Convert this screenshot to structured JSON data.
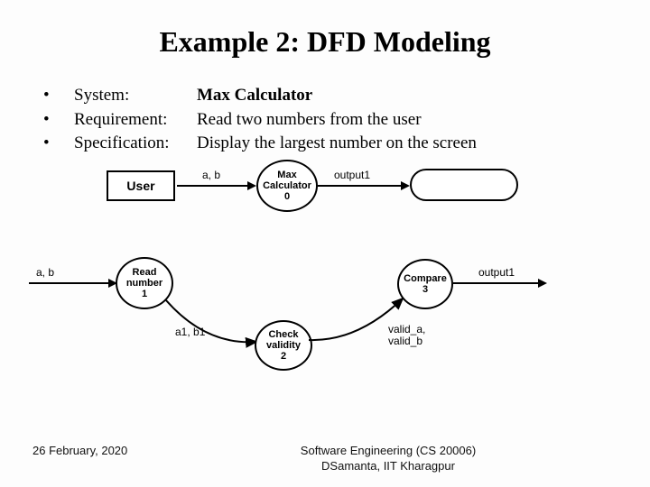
{
  "title": "Example 2: DFD Modeling",
  "bullets": [
    {
      "label": "System:",
      "value": "Max Calculator",
      "bold": true
    },
    {
      "label": "Requirement:",
      "value": "Read two numbers from the user",
      "bold": false
    },
    {
      "label": "Specification:",
      "value": "Display the largest number on the screen",
      "bold": false
    }
  ],
  "dfd0": {
    "external_entity": "User",
    "process": {
      "name": "Max Calculator",
      "id": "0"
    },
    "flow_in": "a, b",
    "flow_out": "output1",
    "sink": ""
  },
  "dfd1": {
    "flow_in": "a, b",
    "p1": {
      "name": "Read number",
      "id": "1"
    },
    "flow_p1_p2": "a1, b1",
    "p2": {
      "name": "Check validity",
      "id": "2"
    },
    "flow_p2_p3": "valid_a, valid_b",
    "p3": {
      "name": "Compare",
      "id": "3"
    },
    "flow_out": "output1"
  },
  "footer": {
    "date": "26 February, 2020",
    "course": "Software Engineering (CS 20006)",
    "author": "DSamanta, IIT Kharagpur"
  }
}
